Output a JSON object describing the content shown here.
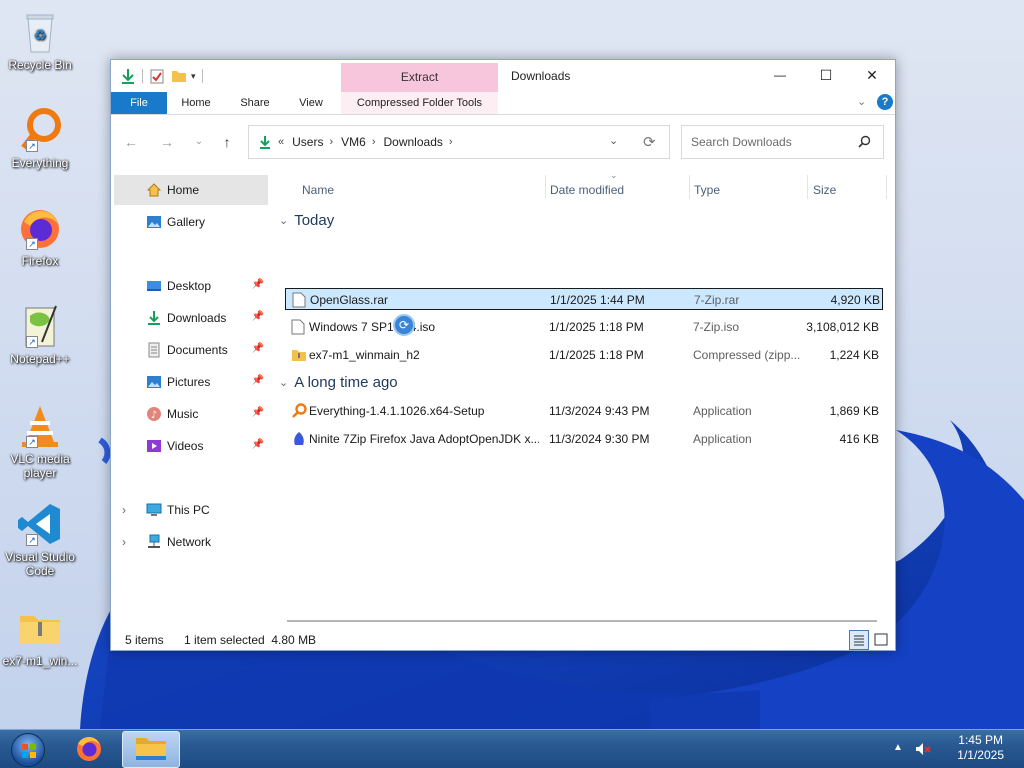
{
  "desktop": {
    "icons": [
      {
        "label": "Recycle Bin"
      },
      {
        "label": "Everything"
      },
      {
        "label": "Firefox"
      },
      {
        "label": "Notepad++"
      },
      {
        "label": "VLC media player"
      },
      {
        "label": "Visual Studio Code"
      },
      {
        "label": "ex7-m1_win..."
      }
    ]
  },
  "window": {
    "title": "Downloads",
    "context_tab_header": "Extract",
    "caption_buttons": {
      "minimize": "—",
      "maximize": "☐",
      "close": "✕"
    },
    "ribbon_tabs": [
      "File",
      "Home",
      "Share",
      "View",
      "Compressed Folder Tools"
    ],
    "breadcrumb": {
      "overflow": "«",
      "parts": [
        "Users",
        "VM6",
        "Downloads"
      ]
    },
    "search_placeholder": "Search Downloads",
    "nav": {
      "home": "Home",
      "gallery": "Gallery",
      "quick_access": [
        "Desktop",
        "Downloads",
        "Documents",
        "Pictures",
        "Music",
        "Videos"
      ],
      "this_pc": "This PC",
      "network": "Network"
    },
    "columns": {
      "name": "Name",
      "date": "Date modified",
      "type": "Type",
      "size": "Size"
    },
    "groups": [
      {
        "label": "Today",
        "files": [
          {
            "name": "OpenGlass.rar",
            "date": "1/1/2025 1:44 PM",
            "type": "7-Zip.rar",
            "size": "4,920 KB",
            "selected": true
          },
          {
            "name": "Windows 7 SP1 x64.iso",
            "date": "1/1/2025 1:18 PM",
            "type": "7-Zip.iso",
            "size": "3,108,012 KB",
            "selected": false
          },
          {
            "name": "ex7-m1_winmain_h2",
            "date": "1/1/2025 1:18 PM",
            "type": "Compressed (zipp...",
            "size": "1,224 KB",
            "selected": false
          }
        ]
      },
      {
        "label": "A long time ago",
        "files": [
          {
            "name": "Everything-1.4.1.1026.x64-Setup",
            "date": "11/3/2024 9:43 PM",
            "type": "Application",
            "size": "1,869 KB",
            "selected": false
          },
          {
            "name": "Ninite 7Zip Firefox Java AdoptOpenJDK x...",
            "date": "11/3/2024 9:30 PM",
            "type": "Application",
            "size": "416 KB",
            "selected": false
          }
        ]
      }
    ],
    "status": {
      "count": "5 items",
      "selection": "1 item selected  4.80 MB"
    }
  },
  "taskbar": {
    "clock_time": "1:45 PM",
    "clock_date": "1/1/2025"
  },
  "colors": {
    "file_tab": "#1979ca",
    "context_tab": "#f7c6dc",
    "selection": "#cce8ff",
    "taskbar": "#2a5991"
  }
}
